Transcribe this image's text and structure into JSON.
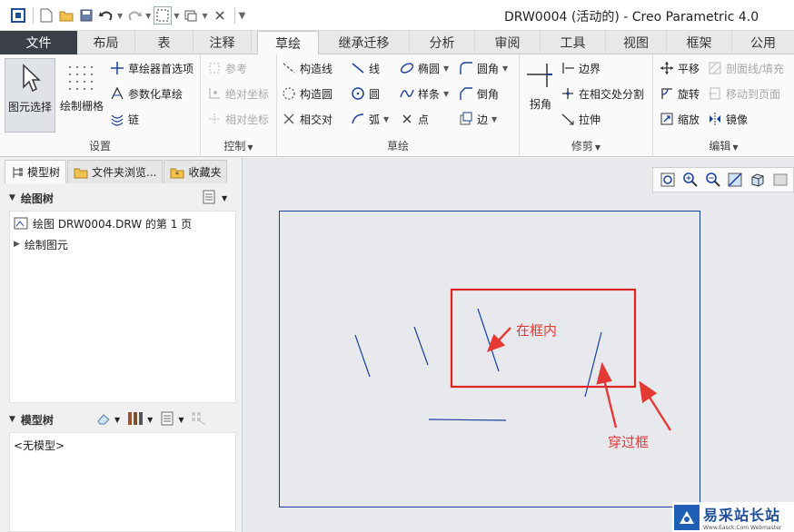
{
  "window": {
    "title": "DRW0004 (活动的) - Creo Parametric 4.0"
  },
  "ribbon_tabs": [
    {
      "label": "文件"
    },
    {
      "label": "布局"
    },
    {
      "label": "表"
    },
    {
      "label": "注释"
    },
    {
      "label": "草绘"
    },
    {
      "label": "继承迁移"
    },
    {
      "label": "分析"
    },
    {
      "label": "审阅"
    },
    {
      "label": "工具"
    },
    {
      "label": "视图"
    },
    {
      "label": "框架"
    },
    {
      "label": "公用"
    }
  ],
  "active_tab": "草绘",
  "groups": {
    "settings": {
      "label": "设置",
      "select": "图元选择",
      "grid": "绘制栅格",
      "prefs": "草绘器首选项",
      "param": "参数化草绘",
      "chain": "链"
    },
    "control": {
      "label": "控制",
      "ref": "参考",
      "abs": "绝对坐标",
      "rel": "相对坐标"
    },
    "sketch": {
      "label": "草绘",
      "construct_line": "构造线",
      "construct_circle": "构造圆",
      "intersect": "相交对",
      "line": "线",
      "circle": "圆",
      "arc": "弧",
      "ellipse": "椭圆",
      "spline": "样条",
      "point": "点",
      "fillet": "圆角",
      "chamfer": "倒角",
      "edge": "边"
    },
    "trim": {
      "label": "修剪",
      "corner": "拐角",
      "boundary": "边界",
      "divide": "在相交处分割",
      "stretch": "拉伸"
    },
    "edit": {
      "label": "编辑",
      "translate": "平移",
      "hatch": "剖面线/填充",
      "rotate": "旋转",
      "move_to_page": "移动到页面",
      "scale": "缩放",
      "mirror": "镜像"
    }
  },
  "panel": {
    "tabs": [
      {
        "label": "模型树"
      },
      {
        "label": "文件夹浏览..."
      },
      {
        "label": "收藏夹"
      }
    ],
    "drawing_tree": {
      "title": "绘图树",
      "items": [
        {
          "label": "绘图 DRW0004.DRW 的第 1 页"
        },
        {
          "label": "绘制图元"
        }
      ]
    },
    "model_tree": {
      "title": "模型树",
      "empty": "<无模型>"
    }
  },
  "annotations": {
    "inside": "在框内",
    "crossing": "穿过框"
  },
  "watermark": {
    "main": "易采站长站",
    "sub": "Www.Easck.Com Webmaster"
  },
  "colors": {
    "file_tab": "#3b3f47",
    "sketch_line": "#1b3f9e",
    "selection_box": "#e02424",
    "annotation": "#e53935",
    "canvas": "#e7e9ed"
  }
}
